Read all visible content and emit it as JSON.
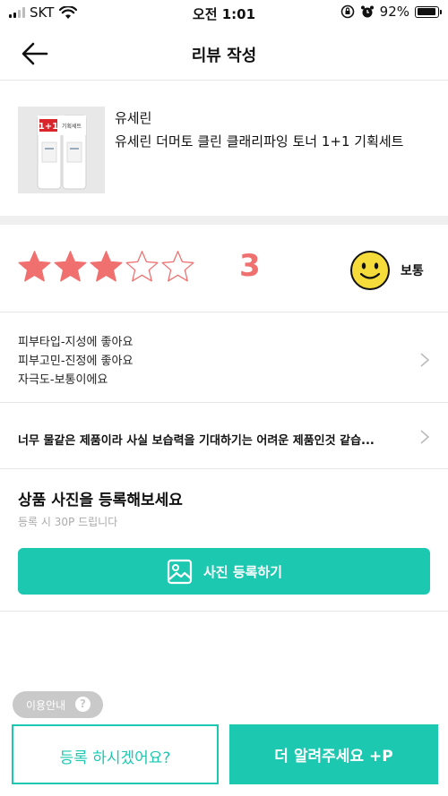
{
  "status_bar": {
    "carrier": "SKT",
    "time": "오전 1:01",
    "battery": "92%",
    "battery_level": 0.92,
    "icons": [
      "signal-icon",
      "wifi-icon",
      "orientation-lock-icon",
      "alarm-icon",
      "battery-icon"
    ]
  },
  "header": {
    "title": "리뷰 작성",
    "back_icon": "arrow-left-icon"
  },
  "product": {
    "brand": "유세린",
    "name": "유세린 더머토 클린 클래리파잉 토너 1+1 기획세트",
    "image_badge": "1+1",
    "image_badge_text": "기획세트"
  },
  "rating": {
    "value": 3,
    "max": 5,
    "display": "3",
    "mood_label": "보통",
    "star_color": "#f07070"
  },
  "tags": [
    "피부타입-지성에 좋아요",
    "피부고민-진정에 좋아요",
    "자극도-보통이에요"
  ],
  "review": {
    "text": "너무 물같은 제품이라 사실 보습력을 기대하기는 어려운 제품인것 같습..."
  },
  "photo": {
    "title": "상품 사진을 등록해보세요",
    "subtitle": "등록 시 30P 드립니다",
    "button_label": "사진 등록하기",
    "button_icon": "image-icon"
  },
  "footer": {
    "info_label": "이용안내",
    "info_icon": "?",
    "register_label": "등록 하시겠어요?",
    "more_label": "더 알려주세요 +P"
  },
  "colors": {
    "accent": "#1dc8b1",
    "star": "#f07070",
    "smiley": "#f5dc3a"
  }
}
